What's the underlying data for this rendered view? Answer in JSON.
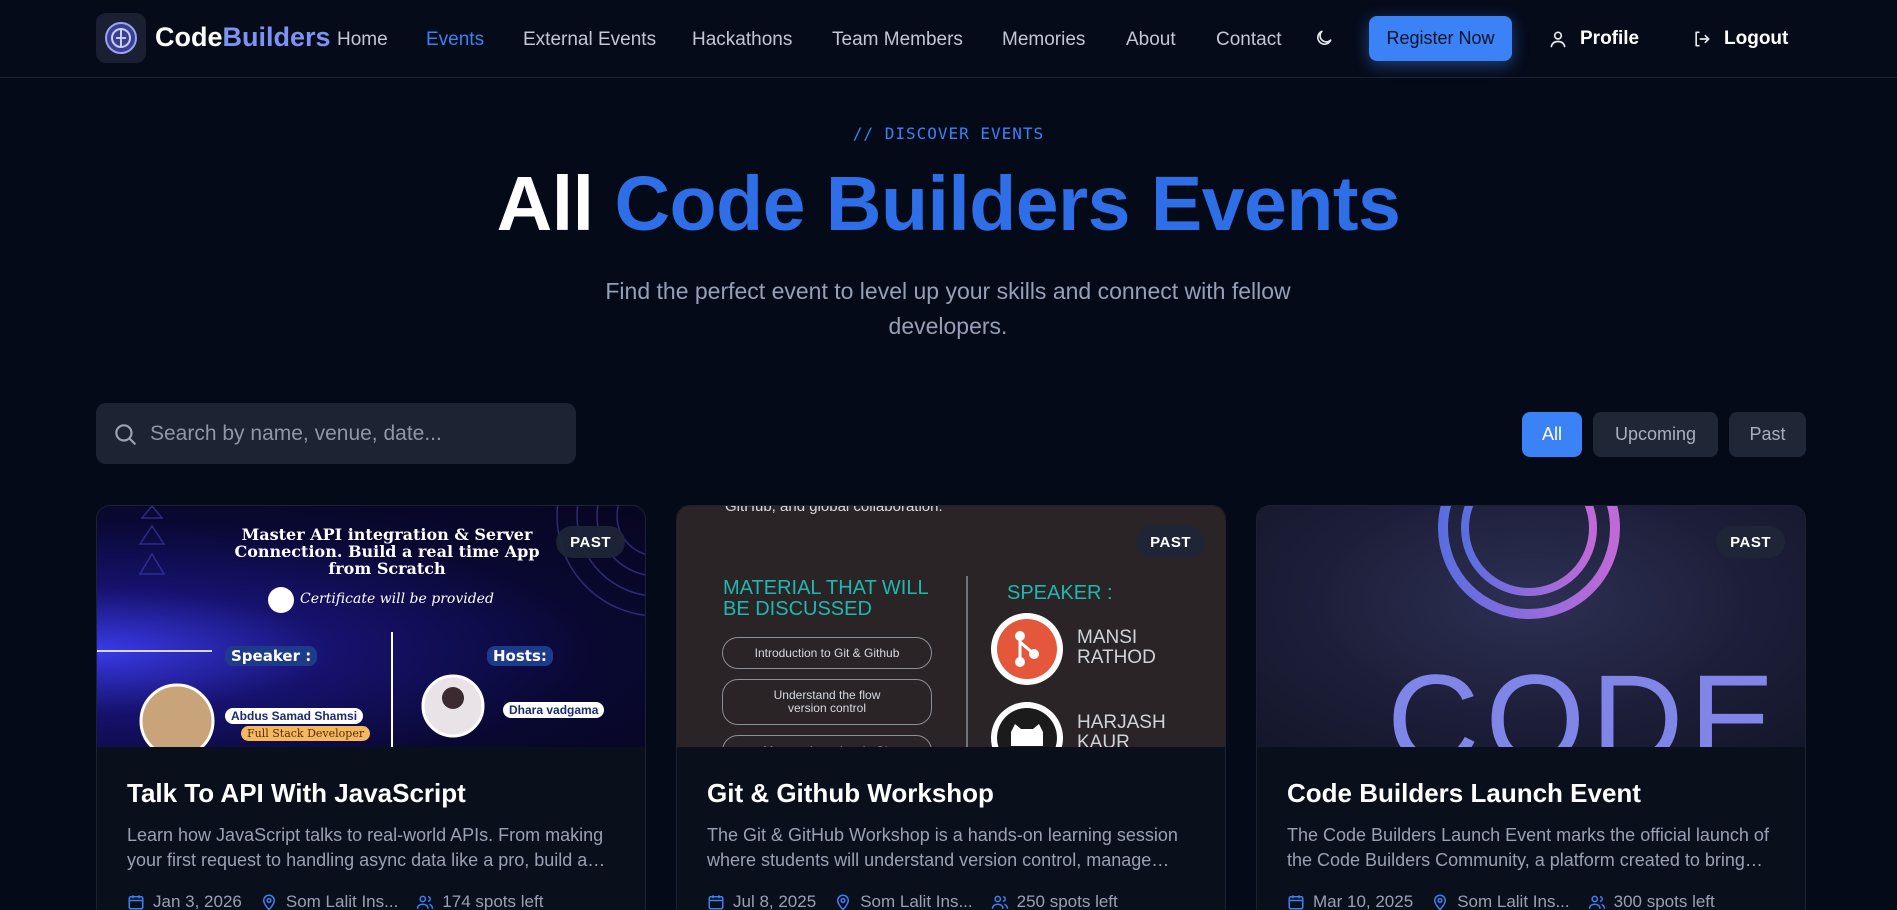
{
  "nav": {
    "brand_first": "Code",
    "brand_second": "Builders",
    "links": [
      "Home",
      "Events",
      "External Events",
      "Hackathons",
      "Team Members",
      "Memories",
      "About",
      "Contact"
    ],
    "active_link": "Events",
    "register_label": "Register Now",
    "profile_label": "Profile",
    "logout_label": "Logout"
  },
  "hero": {
    "eyebrow": "// DISCOVER EVENTS",
    "title_plain": "All ",
    "title_accent": "Code Builders Events",
    "subtitle": "Find the perfect event to level up your skills and connect with fellow developers."
  },
  "search": {
    "placeholder": "Search by name, venue, date..."
  },
  "filters": [
    "All",
    "Upcoming",
    "Past"
  ],
  "active_filter": "All",
  "events": [
    {
      "status": "PAST",
      "title": "Talk To API With JavaScript",
      "description": "Learn how JavaScript talks to real-world APIs. From making your first request to handling async data like a pro, build a real time app from scratch.",
      "date": "Jan 3, 2026",
      "venue": "Som Lalit Ins...",
      "spots": "174 spots left",
      "poster": {
        "headline": "Master API integration & Server Connection. Build a real time App from Scratch",
        "certificate": "Certificate will be provided",
        "speaker_heading": "Speaker :",
        "hosts_heading": "Hosts:",
        "speaker_name": "Abdus Samad Shamsi",
        "speaker_role": "Full Stack Developer",
        "host_name": "Dhara vadgama"
      }
    },
    {
      "status": "PAST",
      "title": "Git & Github Workshop",
      "description": "The Git & GitHub Workshop is a hands-on learning session where students will understand version control, manage repositories, and collaborate globally.",
      "date": "Jul 8, 2025",
      "venue": "Som Lalit Ins...",
      "spots": "250 spots left",
      "poster": {
        "top_text": "GitHub, and global collaboration.",
        "material_heading": "MATERIAL THAT WILL BE DISCUSSED",
        "topics": [
          "Introduction to Git & Github",
          "Understand the flow version control",
          "Manage branches in Git"
        ],
        "speaker_heading": "SPEAKER :",
        "speakers": [
          "MANSI RATHOD",
          "HARJASH KAUR"
        ]
      }
    },
    {
      "status": "PAST",
      "title": "Code Builders Launch Event",
      "description": "The Code Builders Launch Event marks the official launch of the Code Builders Community, a platform created to bring developers together.",
      "date": "Mar 10, 2025",
      "venue": "Som Lalit Ins...",
      "spots": "300 spots left",
      "poster": {
        "word": "CODE"
      }
    }
  ],
  "colors": {
    "background": "#050a18",
    "accent": "#3b82f6",
    "card": "#0a0f1c"
  }
}
